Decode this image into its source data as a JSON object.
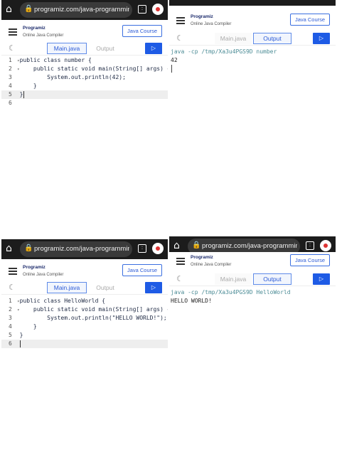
{
  "browser": {
    "url": "programiz.com/java-programming/on",
    "url_br": "programiz.com/java-programming/on",
    "tab_count": ":"
  },
  "header": {
    "logo_name": "Programiz",
    "subtitle": "Online Java Compiler",
    "course_label": "Java Course"
  },
  "toolbar": {
    "main_tab": "Main.java",
    "output_tab": "Output",
    "run_label": "▷"
  },
  "editor_top": {
    "lines": [
      {
        "num": "1",
        "fold": "▾",
        "text": "public class number {"
      },
      {
        "num": "2",
        "fold": "▾",
        "text": "    public static void main(String[] args) {"
      },
      {
        "num": "3",
        "fold": " ",
        "text": "        System.out.println(42);"
      },
      {
        "num": "4",
        "fold": " ",
        "text": "    }"
      },
      {
        "num": "5",
        "fold": " ",
        "text": "}"
      },
      {
        "num": "6",
        "fold": " ",
        "text": ""
      }
    ]
  },
  "output_top": {
    "command": "java -cp /tmp/Xa3u4PGS9D number",
    "result": "42"
  },
  "editor_bottom": {
    "lines": [
      {
        "num": "1",
        "fold": "▾",
        "text": "public class HelloWorld {"
      },
      {
        "num": "2",
        "fold": "▾",
        "text": "    public static void main(String[] args) {"
      },
      {
        "num": "3",
        "fold": " ",
        "text": "        System.out.println(\"HELLO WORLD!\");"
      },
      {
        "num": "4",
        "fold": " ",
        "text": "    }"
      },
      {
        "num": "5",
        "fold": " ",
        "text": "}"
      },
      {
        "num": "6",
        "fold": " ",
        "text": ""
      }
    ]
  },
  "output_bottom": {
    "command": "java -cp /tmp/Xa3u4PGS9D HelloWorld",
    "result": "HELLO WORLD!"
  },
  "colors": {
    "accent": "#1e5be5",
    "output_command": "#4c8c96"
  }
}
